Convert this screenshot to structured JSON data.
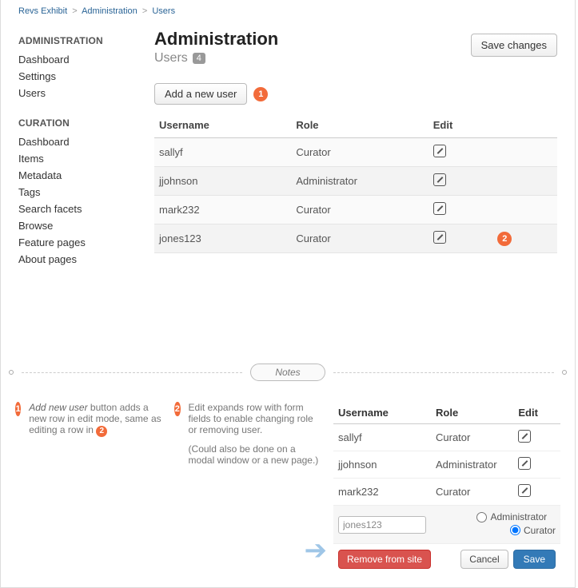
{
  "breadcrumb": {
    "a": "Revs Exhibit",
    "b": "Administration",
    "c": "Users"
  },
  "sidebar": {
    "admin_header": "ADMINISTRATION",
    "admin_items": [
      "Dashboard",
      "Settings",
      "Users"
    ],
    "curation_header": "CURATION",
    "curation_items": [
      "Dashboard",
      "Items",
      "Metadata",
      "Tags",
      "Search facets",
      "Browse",
      "Feature pages",
      "About pages"
    ]
  },
  "main": {
    "title": "Administration",
    "subtitle": "Users",
    "count": "4",
    "save_changes": "Save changes",
    "add_user": "Add a new user",
    "headers": {
      "username": "Username",
      "role": "Role",
      "edit": "Edit"
    },
    "rows": [
      {
        "username": "sallyf",
        "role": "Curator"
      },
      {
        "username": "jjohnson",
        "role": "Administrator"
      },
      {
        "username": "mark232",
        "role": "Curator"
      },
      {
        "username": "jones123",
        "role": "Curator"
      }
    ],
    "callout1": "1",
    "callout2": "2"
  },
  "notes": {
    "pill": "Notes",
    "n1_num": "1",
    "n1_em": "Add new user",
    "n1_rest": " button adds a new row in edit mode, same as editing a row in ",
    "n1_ref": "2",
    "n2_num": "2",
    "n2_text": "Edit expands row with form fields to enable changing role or removing user.",
    "n2_sub": "(Could also be done on a modal window or a new page.)"
  },
  "demo": {
    "headers": {
      "username": "Username",
      "role": "Role",
      "edit": "Edit"
    },
    "rows": [
      {
        "username": "sallyf",
        "role": "Curator"
      },
      {
        "username": "jjohnson",
        "role": "Administrator"
      },
      {
        "username": "mark232",
        "role": "Curator"
      }
    ],
    "editing": {
      "username": "jones123",
      "opt_admin": "Administrator",
      "opt_curator": "Curator",
      "selected": "curator"
    },
    "remove": "Remove from site",
    "cancel": "Cancel",
    "save": "Save"
  }
}
